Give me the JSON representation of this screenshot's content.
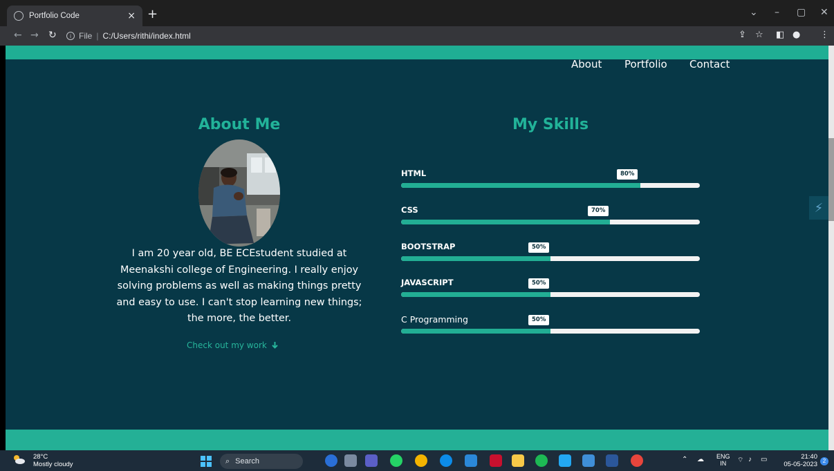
{
  "browser": {
    "tab_title": "Portfolio Code",
    "tab_close": "×",
    "new_tab": "+",
    "address_scheme": "File",
    "address_path": "C:/Users/rithi/index.html"
  },
  "nav": {
    "about": "About",
    "portfolio": "Portfolio",
    "contact": "Contact"
  },
  "about": {
    "heading": "About Me",
    "bio": "I am 20 year old, BE ECEstudent studied at Meenakshi college of Engineering. I really enjoy solving problems as well as making things pretty and easy to use. I can't stop learning new things; the more, the better.",
    "cta": "Check out my work",
    "cta_icon": "arrow-down-icon"
  },
  "skills": {
    "heading": "My Skills",
    "items": [
      {
        "name": "HTML",
        "percent_label": "80%",
        "level": 80
      },
      {
        "name": "CSS",
        "percent_label": "70%",
        "level": 70
      },
      {
        "name": "BOOTSTRAP",
        "percent_label": "50%",
        "level": 50
      },
      {
        "name": "JAVASCRIPT",
        "percent_label": "50%",
        "level": 50
      },
      {
        "name": "C Programming",
        "percent_label": "50%",
        "level": 50
      }
    ]
  },
  "colors": {
    "page_bg": "#073847",
    "accent": "#22b399",
    "bar_track": "#f2f2f2"
  },
  "taskbar": {
    "temperature": "28°C",
    "weather": "Mostly cloudy",
    "search": "Search",
    "lang_top": "ENG",
    "lang_bottom": "IN",
    "time": "21:40",
    "date": "05-05-2023",
    "notifications": "2"
  }
}
